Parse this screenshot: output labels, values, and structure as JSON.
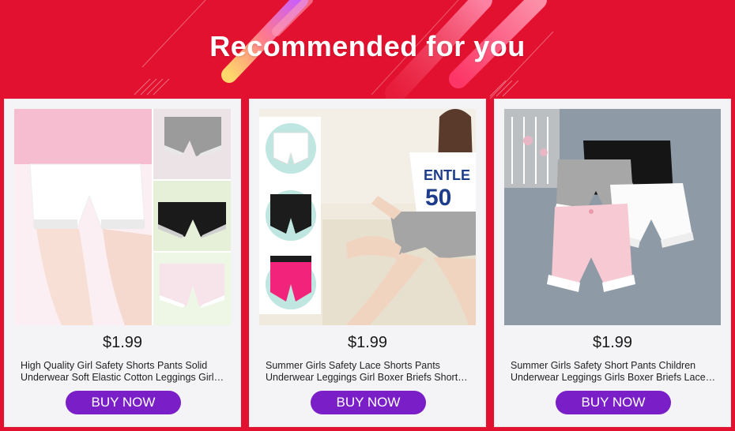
{
  "header": {
    "title": "Recommended for you"
  },
  "colors": {
    "background": "#e2112f",
    "button": "#7a1fc8",
    "card": "#f4f4f6"
  },
  "products": [
    {
      "price": "$1.99",
      "name": "High Quality Girl Safety Shorts Pants Solid Underwear Soft Elastic Cotton Leggings Girls Short Pants",
      "button_label": "BUY NOW",
      "image_icon": "safety-shorts-collage"
    },
    {
      "price": "$1.99",
      "name": "Summer Girls Safety Lace Shorts Pants Underwear Leggings Girl Boxer Briefs Short Beach Shorts",
      "button_label": "BUY NOW",
      "image_icon": "girl-wearing-shorts-photo"
    },
    {
      "price": "$1.99",
      "name": "Summer Girls Safety Short Pants Children Underwear Leggings Girls Boxer Briefs Lace Shorts",
      "button_label": "BUY NOW",
      "image_icon": "lace-shorts-flatlay"
    }
  ]
}
